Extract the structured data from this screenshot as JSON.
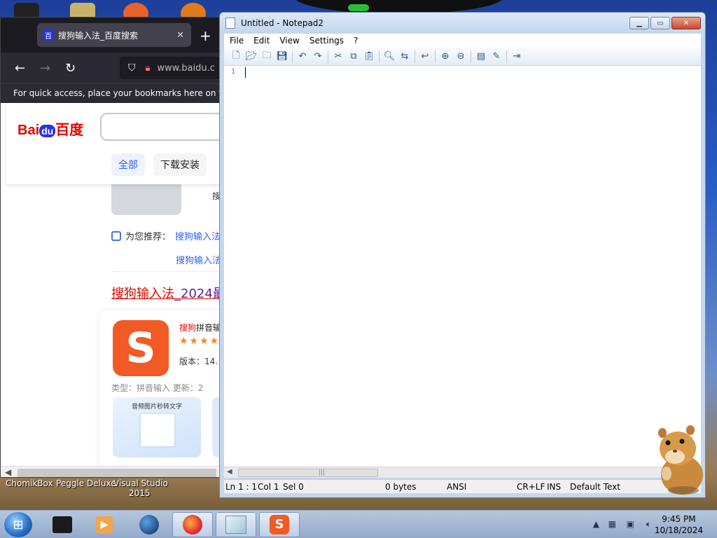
{
  "desktop": {
    "icon_labels": [
      "ChomikBox",
      "Peggle Deluxe",
      "Visual Studio",
      "2015"
    ]
  },
  "firefox": {
    "tab_title": "搜狗输入法_百度搜索",
    "tab_favicon": "百",
    "url": "www.baidu.c",
    "bookmarks_hint": "For quick access, place your bookmarks here on the boo",
    "baidu": {
      "logo_part1": "Bai",
      "logo_part2": "du",
      "logo_part3": "百度",
      "tabs": [
        "全部",
        "下载安装"
      ],
      "side_text": "搜",
      "recommend_label": "为您推荐：",
      "recommend_links": [
        "搜狗输入法",
        "搜狗输入法"
      ],
      "result_title_red": "搜狗输入法",
      "result_title_rest": "_2024最",
      "card_title_red": "搜狗",
      "card_title_rest": "拼音输",
      "stars": "★★★★",
      "version": "版本：14.",
      "meta": "类型：拼音输入    更新：2",
      "thumb_caption": "音频图片秒转文字",
      "logo_glyph": "S"
    }
  },
  "notepad": {
    "title": "Untitled - Notepad2",
    "menu": [
      "File",
      "Edit",
      "View",
      "Settings",
      "?"
    ],
    "line_number": "1",
    "status": {
      "position": "Ln 1 : 1",
      "col": "Col 1",
      "sel": "Sel 0",
      "size": "0 bytes",
      "encoding": "ANSI",
      "line_endings": "CR+LF",
      "mode": "INS",
      "scheme": "Default Text"
    }
  },
  "taskbar": {
    "time": "9:45 PM",
    "date": "10/18/2024"
  },
  "colors": {
    "baidu_red": "#e10601",
    "baidu_blue": "#2932e1",
    "sogou_orange": "#f15a24",
    "link_blue": "#315efb"
  }
}
